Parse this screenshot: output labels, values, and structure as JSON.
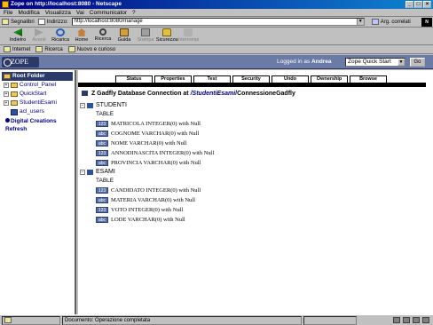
{
  "window": {
    "title": "Zope on http://localhost:8080 - Netscape"
  },
  "menu": [
    "File",
    "Modifica",
    "Visualizza",
    "Vai",
    "Communicator",
    "?"
  ],
  "location": {
    "bookmarks_label": "Segnalibri",
    "address_label": "Indirizzo:",
    "url": "http://localhost:8080/manage",
    "related_label": "Arg. correlati"
  },
  "toolbar": {
    "back": "Indietro",
    "forward": "Avanti",
    "reload": "Ricarica",
    "home": "Home",
    "search": "Ricerca",
    "guide": "Guida",
    "print": "Stampa",
    "security": "Sicurezza",
    "stop": "Interrompi"
  },
  "personal_bar": {
    "internet": "Internet",
    "search": "Ricerca",
    "new": "Nuovo e curioso"
  },
  "zope": {
    "logo": "ZOPE",
    "logged_prefix": "Logged in as",
    "user": "Andrea",
    "quick_start_option": "Zope Quick Start",
    "go_label": "Go"
  },
  "tree": {
    "root": "Root Folder",
    "items": [
      {
        "label": "Control_Panel",
        "type": "folder"
      },
      {
        "label": "QuickStart",
        "type": "folder"
      },
      {
        "label": "StudentiEsami",
        "type": "folder"
      },
      {
        "label": "acl_users",
        "type": "acl"
      }
    ],
    "digital_creations": "Digital Creations",
    "refresh": "Refresh"
  },
  "tabs": [
    "Status",
    "Properties",
    "Test",
    "Security",
    "Undo",
    "Ownership",
    "Browse"
  ],
  "breadcrumb": {
    "prefix": "Z Gadfly Database Connection at",
    "path": "/StudentiEsami",
    "sep": "/",
    "name": "ConnessioneGadfly"
  },
  "schema": [
    {
      "name": "STUDENTI",
      "kind": "TABLE",
      "columns": [
        {
          "badge": "123",
          "text": "MATRICOLA INTEGER(0) with Null"
        },
        {
          "badge": "abc",
          "text": "COGNOME VARCHAR(0) with Null"
        },
        {
          "badge": "abc",
          "text": "NOME VARCHAR(0) with Null"
        },
        {
          "badge": "123",
          "text": "ANNODINASCITA INTEGER(0) with Null"
        },
        {
          "badge": "abc",
          "text": "PROVINCIA VARCHAR(0) with Null"
        }
      ]
    },
    {
      "name": "ESAMI",
      "kind": "TABLE",
      "columns": [
        {
          "badge": "123",
          "text": "CANDIDATO INTEGER(0) with Null"
        },
        {
          "badge": "abc",
          "text": "MATERIA VARCHAR(0) with Null"
        },
        {
          "badge": "123",
          "text": "VOTO INTEGER(0) with Null"
        },
        {
          "badge": "abc",
          "text": "LODE VARCHAR(0) with Null"
        }
      ]
    }
  ],
  "status": {
    "text": "Documento: Operazione completata"
  },
  "colors": {
    "title_start": "#000080",
    "title_end": "#1084d0",
    "zope_header": "#6b7ba8",
    "zope_dark": "#2c3a6a"
  }
}
